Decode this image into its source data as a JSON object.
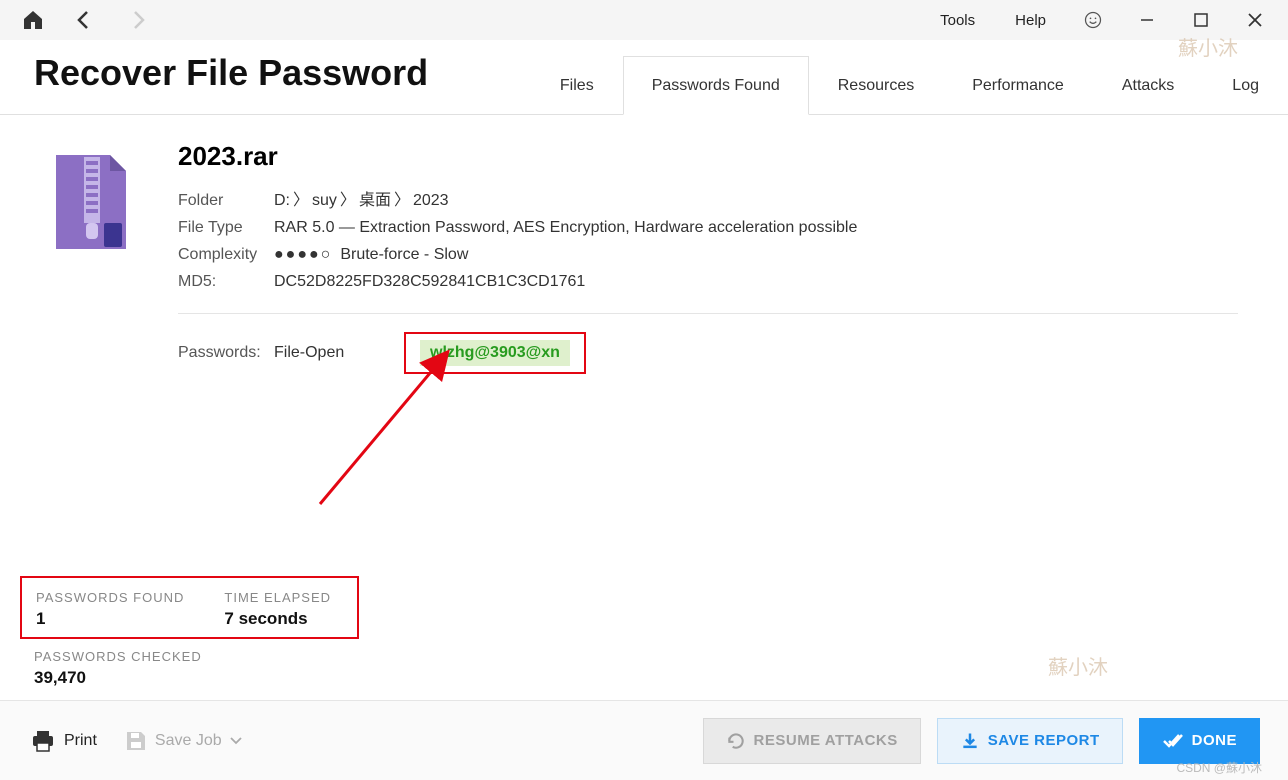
{
  "menu": {
    "tools": "Tools",
    "help": "Help"
  },
  "page_title": "Recover File Password",
  "tabs": {
    "files": "Files",
    "passwords_found": "Passwords Found",
    "resources": "Resources",
    "performance": "Performance",
    "attacks": "Attacks",
    "log": "Log"
  },
  "file": {
    "name": "2023.rar",
    "folder_label": "Folder",
    "folder_parts": [
      "D:",
      "suy",
      "桌面",
      "2023"
    ],
    "filetype_label": "File Type",
    "filetype_value": "RAR 5.0 — Extraction Password, AES Encryption, Hardware acceleration possible",
    "complexity_label": "Complexity",
    "complexity_value": "Brute-force - Slow",
    "md5_label": "MD5:",
    "md5_value": "DC52D8225FD328C592841CB1C3CD1761"
  },
  "passwords": {
    "label": "Passwords:",
    "type": "File-Open",
    "value": "wlzhg@3903@xn"
  },
  "stats": {
    "found_label": "PASSWORDS FOUND",
    "found_value": "1",
    "elapsed_label": "TIME ELAPSED",
    "elapsed_value": "7 seconds",
    "checked_label": "PASSWORDS CHECKED",
    "checked_value": "39,470"
  },
  "bottom": {
    "print": "Print",
    "save_job": "Save Job",
    "resume": "RESUME ATTACKS",
    "save_report": "SAVE REPORT",
    "done": "DONE"
  },
  "watermarks": {
    "name": "蘇小沐",
    "csdn": "CSDN @蘇小沐"
  }
}
